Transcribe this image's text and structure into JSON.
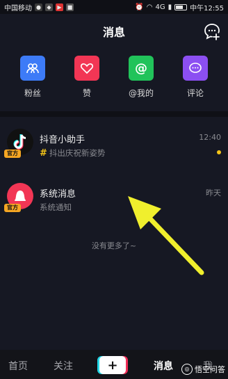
{
  "status_bar": {
    "carrier": "中国移动",
    "network": "4G",
    "time_label": "中午12:55"
  },
  "header": {
    "title": "消息",
    "chat_icon": "chat-bubble-plus-icon"
  },
  "actions": [
    {
      "label": "粉丝",
      "icon": "fans-icon",
      "color": "#3d7bf7"
    },
    {
      "label": "赞",
      "icon": "heart-icon",
      "color": "#f23655"
    },
    {
      "label": "@我的",
      "icon": "at-icon",
      "color": "#21c35a"
    },
    {
      "label": "评论",
      "icon": "comment-icon",
      "color": "#8c4ff2"
    }
  ],
  "messages": [
    {
      "title": "抖音小助手",
      "subtitle": "抖出庆祝新姿势",
      "time": "12:40",
      "badge": "官方",
      "unread": true
    },
    {
      "title": "系统消息",
      "subtitle": "系统通知",
      "time": "昨天",
      "badge": "官方",
      "unread": false
    }
  ],
  "footer_note": "没有更多了~",
  "bottom_nav": {
    "home": "首页",
    "follow": "关注",
    "plus": "+",
    "messages": "消息",
    "me": "我"
  },
  "watermark": "悟空问答",
  "colors": {
    "background": "#161823",
    "accent_yellow": "#f5c518",
    "badge": "#f5a623"
  }
}
